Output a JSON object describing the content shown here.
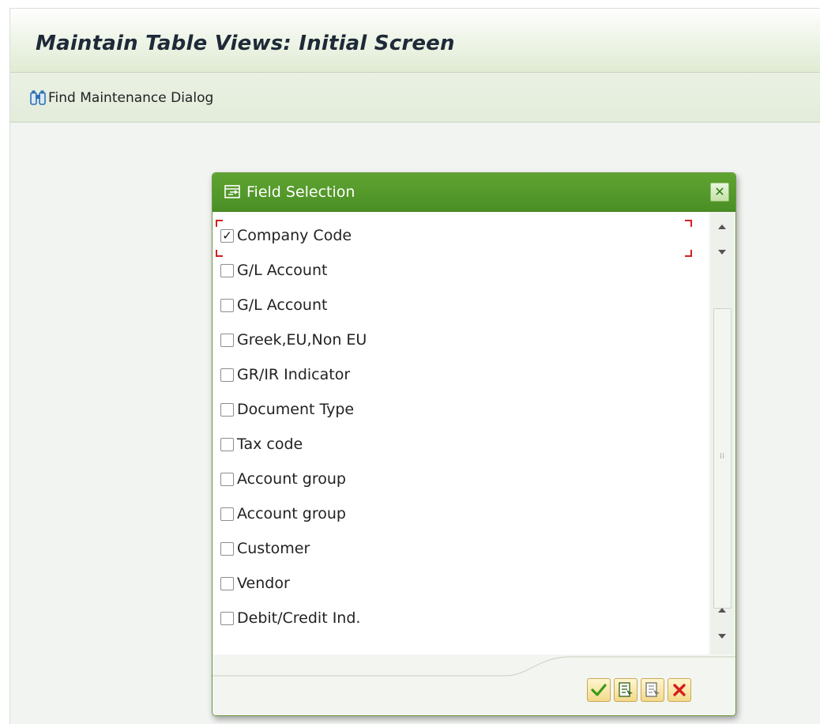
{
  "screen": {
    "title": "Maintain Table Views: Initial Screen",
    "toolbar": {
      "find_label": "Find Maintenance Dialog",
      "find_icon": "binoculars-icon"
    }
  },
  "dialog": {
    "title": "Field Selection",
    "title_icon": "field-selection-icon",
    "close_icon": "close-icon",
    "fields": [
      {
        "label": "Company Code",
        "checked": true
      },
      {
        "label": "G/L Account",
        "checked": false
      },
      {
        "label": "G/L Account",
        "checked": false
      },
      {
        "label": "Greek,EU,Non EU",
        "checked": false
      },
      {
        "label": "GR/IR Indicator",
        "checked": false
      },
      {
        "label": "Document Type",
        "checked": false
      },
      {
        "label": "Tax code",
        "checked": false
      },
      {
        "label": "Account group",
        "checked": false
      },
      {
        "label": "Account group",
        "checked": false
      },
      {
        "label": "Customer",
        "checked": false
      },
      {
        "label": "Vendor",
        "checked": false
      },
      {
        "label": "Debit/Credit Ind.",
        "checked": false
      }
    ],
    "footer_buttons": [
      "confirm-icon",
      "select-all-icon",
      "deselect-all-icon",
      "cancel-icon"
    ]
  },
  "colors": {
    "dialog_header": "#4a8f24",
    "title_text": "#1e2a38",
    "focus_marker": "#d42020",
    "button_face": "#f3d98a"
  }
}
